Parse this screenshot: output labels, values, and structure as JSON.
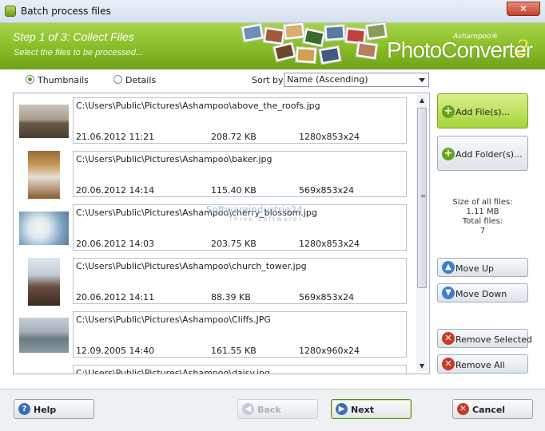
{
  "window": {
    "title": "Batch process files",
    "close_label": "✕"
  },
  "header": {
    "step": "Step 1 of 3: Collect Files",
    "subtitle": "Select the files to be processed...",
    "brand": "Ashampoo®",
    "product": "PhotoConverter",
    "version": "2"
  },
  "view": {
    "thumbnails_label": "Thumbnails",
    "details_label": "Details",
    "selected": "Thumbnails",
    "sort_label": "Sort by:",
    "sort_value": "Name (Ascending)"
  },
  "files": [
    {
      "path": "C:\\Users\\Public\\Pictures\\Ashampoo\\above_the_roofs.jpg",
      "date": "21.06.2012 11:21",
      "size": "208.72 KB",
      "dims": "1280x853x24"
    },
    {
      "path": "C:\\Users\\Public\\Pictures\\Ashampoo\\baker.jpg",
      "date": "20.06.2012 14:14",
      "size": "115.40 KB",
      "dims": "569x853x24"
    },
    {
      "path": "C:\\Users\\Public\\Pictures\\Ashampoo\\cherry_blossom.jpg",
      "date": "20.06.2012 14:03",
      "size": "203.75 KB",
      "dims": "1280x853x24"
    },
    {
      "path": "C:\\Users\\Public\\Pictures\\Ashampoo\\church_tower.jpg",
      "date": "20.06.2012 14:11",
      "size": "88.39 KB",
      "dims": "569x853x24"
    },
    {
      "path": "C:\\Users\\Public\\Pictures\\Ashampoo\\Cliffs.JPG",
      "date": "12.09.2005 14:40",
      "size": "161.55 KB",
      "dims": "1280x960x24"
    },
    {
      "path": "C:\\Users\\Public\\Pictures\\Ashampoo\\daisy.jpg",
      "date": "",
      "size": "",
      "dims": ""
    }
  ],
  "actions": {
    "add_files": "Add File(s)...",
    "add_folder": "Add Folder(s)...",
    "move_up": "Move Up",
    "move_down": "Move Down",
    "remove_selected": "Remove Selected",
    "remove_all": "Remove All"
  },
  "stats": {
    "size_label": "Size of all files:",
    "size_value": "1.11 MB",
    "total_label": "Total files:",
    "total_value": "7"
  },
  "footer": {
    "help": "Help",
    "back": "Back",
    "next": "Next",
    "cancel": "Cancel"
  },
  "watermark": {
    "line1": "Softwareindustrie24",
    "line2": "Think Software!"
  },
  "colors": {
    "banner_green": "#8cc12c",
    "accent_green": "#a6d33b"
  }
}
